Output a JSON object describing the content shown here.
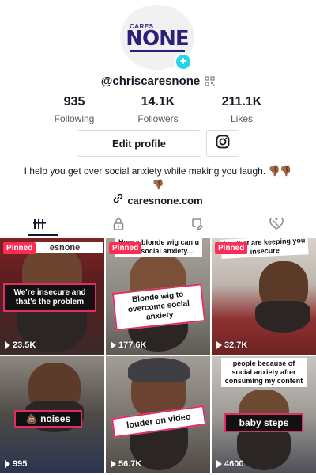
{
  "profile": {
    "avatar_logo_top": "CARES",
    "avatar_logo_main": "NONE",
    "username": "@chriscaresnone",
    "stats": [
      {
        "value": "935",
        "label": "Following"
      },
      {
        "value": "14.1K",
        "label": "Followers"
      },
      {
        "value": "211.1K",
        "label": "Likes"
      }
    ],
    "edit_button": "Edit profile",
    "bio": "I help you get over social anxiety while making you laugh.",
    "bio_emoji": "👎🏾👎🏾👎🏾",
    "link": "caresnone.com"
  },
  "tabs": [
    {
      "name": "videos",
      "icon": "grid-icon"
    },
    {
      "name": "private",
      "icon": "lock-icon"
    },
    {
      "name": "reposts",
      "icon": "repost-icon"
    },
    {
      "name": "liked",
      "icon": "heart-icon"
    }
  ],
  "videos": [
    {
      "pinned": "Pinned",
      "caption": "We're insecure and that's the problem",
      "top_caption": "esnone",
      "views": "23.5K"
    },
    {
      "pinned": "Pinned",
      "caption": "Blonde wig to overcome social anxiety",
      "top_caption": "How a blonde wig can u with social anxiety...",
      "views": "177.6K"
    },
    {
      "pinned": "Pinned",
      "caption": "",
      "top_caption": "ing that are keeping you insecure",
      "views": "32.7K"
    },
    {
      "pinned": "",
      "caption": "💩 noises",
      "top_caption": "",
      "views": "995"
    },
    {
      "pinned": "",
      "caption": "louder on video",
      "top_caption": "",
      "views": "56.7K"
    },
    {
      "pinned": "",
      "caption": "baby steps",
      "top_caption": "people because of social anxiety after consuming my content",
      "views": "4600"
    }
  ],
  "colors": {
    "accent": "#fe2c55",
    "plus": "#20d5ec",
    "brand": "#2a1f7a"
  }
}
